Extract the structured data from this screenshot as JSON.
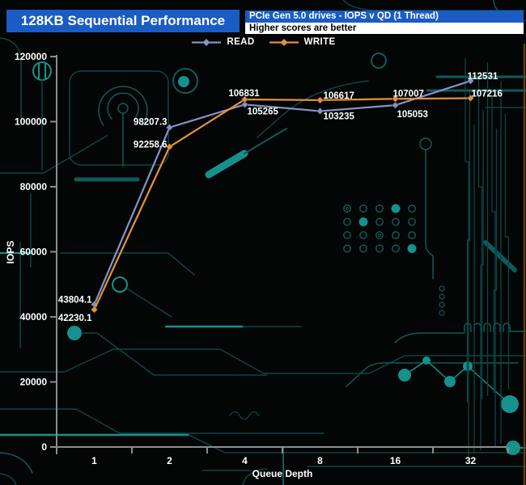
{
  "header": {
    "title": "128KB Sequential Performance",
    "subtitle": "PCIe Gen 5.0 drives - IOPS v QD (1 Thread)",
    "note": "Higher scores are better"
  },
  "colors": {
    "title_bar": "#1a5cc4",
    "read": "#8193c7",
    "write": "#e2913c",
    "axis": "#8c8c8c",
    "background": "#040505",
    "circuit_dark": "#0a4646",
    "circuit_mid": "#0d5c5a",
    "circuit_bright": "#16918d",
    "circuit_copper": "#5e3c18"
  },
  "chart_data": {
    "type": "line",
    "title": "128KB Sequential Performance",
    "subtitle": "PCIe Gen 5.0 drives - IOPS v QD (1 Thread)",
    "note": "Higher scores are better",
    "x": [
      1,
      2,
      4,
      8,
      16,
      32
    ],
    "xlabel": "Queue Depth",
    "ylabel": "IOPS",
    "ylim": [
      0,
      120000
    ],
    "ytick_step": 20000,
    "grid": false,
    "legend_position": "top-center",
    "marker": "diamond",
    "series": [
      {
        "name": "READ",
        "color": "#8193c7",
        "values": [
          43804.1,
          98207.3,
          105265,
          103235,
          105053,
          112531
        ],
        "labels": [
          "43804.1",
          "98207.3",
          "105265",
          "103235",
          "105053",
          "112531"
        ]
      },
      {
        "name": "WRITE",
        "color": "#e2913c",
        "values": [
          42230.1,
          92258.6,
          106831,
          106617,
          107007,
          107216
        ],
        "labels": [
          "42230.1",
          "92258.6",
          "106831",
          "106617",
          "107007",
          "107216"
        ]
      }
    ]
  }
}
